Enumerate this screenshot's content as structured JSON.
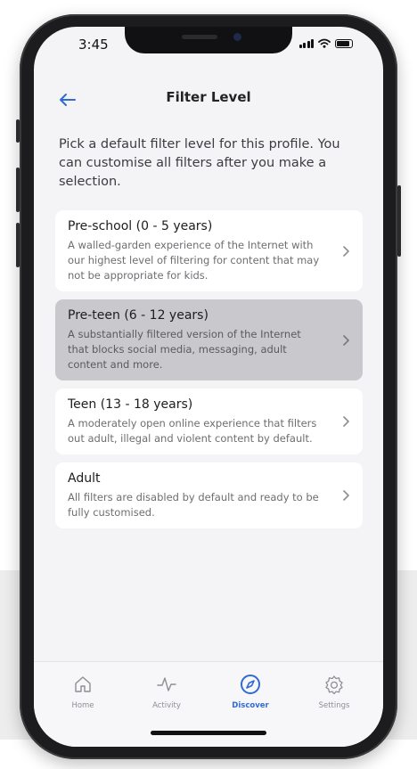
{
  "status_bar": {
    "time": "3:45"
  },
  "header": {
    "title": "Filter Level",
    "back_icon": "arrow-left-icon"
  },
  "intro": "Pick a default filter level for this profile. You can customise all filters after you make a selection.",
  "options": [
    {
      "title": "Pre-school (0 - 5 years)",
      "description": "A walled-garden experience of the Internet with our highest level of filtering for content that may not be appropriate for kids.",
      "selected": false
    },
    {
      "title": "Pre-teen (6 - 12 years)",
      "description": "A substantially filtered version of the Internet that blocks social media, messaging, adult content and more.",
      "selected": true
    },
    {
      "title": "Teen (13 - 18 years)",
      "description": "A moderately open online experience that filters out adult, illegal and violent content by default.",
      "selected": false
    },
    {
      "title": "Adult",
      "description": "All filters are disabled by default and ready to be fully customised.",
      "selected": false
    }
  ],
  "tabbar": {
    "tabs": [
      {
        "label": "Home",
        "icon": "home-icon",
        "active": false
      },
      {
        "label": "Activity",
        "icon": "activity-icon",
        "active": false
      },
      {
        "label": "Discover",
        "icon": "compass-icon",
        "active": true
      },
      {
        "label": "Settings",
        "icon": "gear-icon",
        "active": false
      }
    ]
  },
  "colors": {
    "accent": "#2f6bd8",
    "selected_card": "#c9c8cd",
    "screen_bg": "#f4f3f6"
  }
}
